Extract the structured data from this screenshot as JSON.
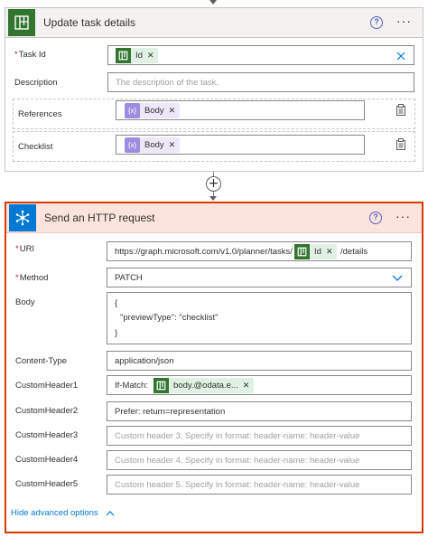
{
  "colors": {
    "accent": "#0078d4",
    "planner_green": "#31752f",
    "selected_border": "#d83b01",
    "required": "#a4262c"
  },
  "card1": {
    "title": "Update task details",
    "icon": "planner-icon",
    "fields": {
      "task_id": {
        "label": "Task Id",
        "required": true,
        "token": "Id",
        "clear_icon": "close-icon"
      },
      "description": {
        "label": "Description",
        "placeholder": "The description of the task."
      },
      "references": {
        "label": "References",
        "token": "Body"
      },
      "checklist": {
        "label": "Checklist",
        "token": "Body"
      }
    }
  },
  "card2": {
    "title": "Send an HTTP request",
    "icon": "http-icon",
    "fields": {
      "uri": {
        "label": "URI",
        "required": true,
        "prefix": "https://graph.microsoft.com/v1.0/planner/tasks/",
        "token": "Id",
        "suffix": "/details"
      },
      "method": {
        "label": "Method",
        "required": true,
        "value": "PATCH"
      },
      "body": {
        "label": "Body",
        "lines": [
          "{",
          "\"previewType\": \"checklist\"",
          "}"
        ]
      },
      "content_type": {
        "label": "Content-Type",
        "value": "application/json"
      },
      "custom_header_1": {
        "label": "CustomHeader1",
        "prefix": "If-Match:",
        "token": "body.@odata.e..."
      },
      "custom_header_2": {
        "label": "CustomHeader2",
        "value": "Prefer: return=representation"
      },
      "custom_header_3": {
        "label": "CustomHeader3",
        "placeholder": "Custom header 3. Specify in format: header-name: header-value"
      },
      "custom_header_4": {
        "label": "CustomHeader4",
        "placeholder": "Custom header 4. Specify in format: header-name: header-value"
      },
      "custom_header_5": {
        "label": "CustomHeader5",
        "placeholder": "Custom header 5. Specify in format: header-name: header-value"
      }
    },
    "hide_advanced": "Hide advanced options"
  }
}
